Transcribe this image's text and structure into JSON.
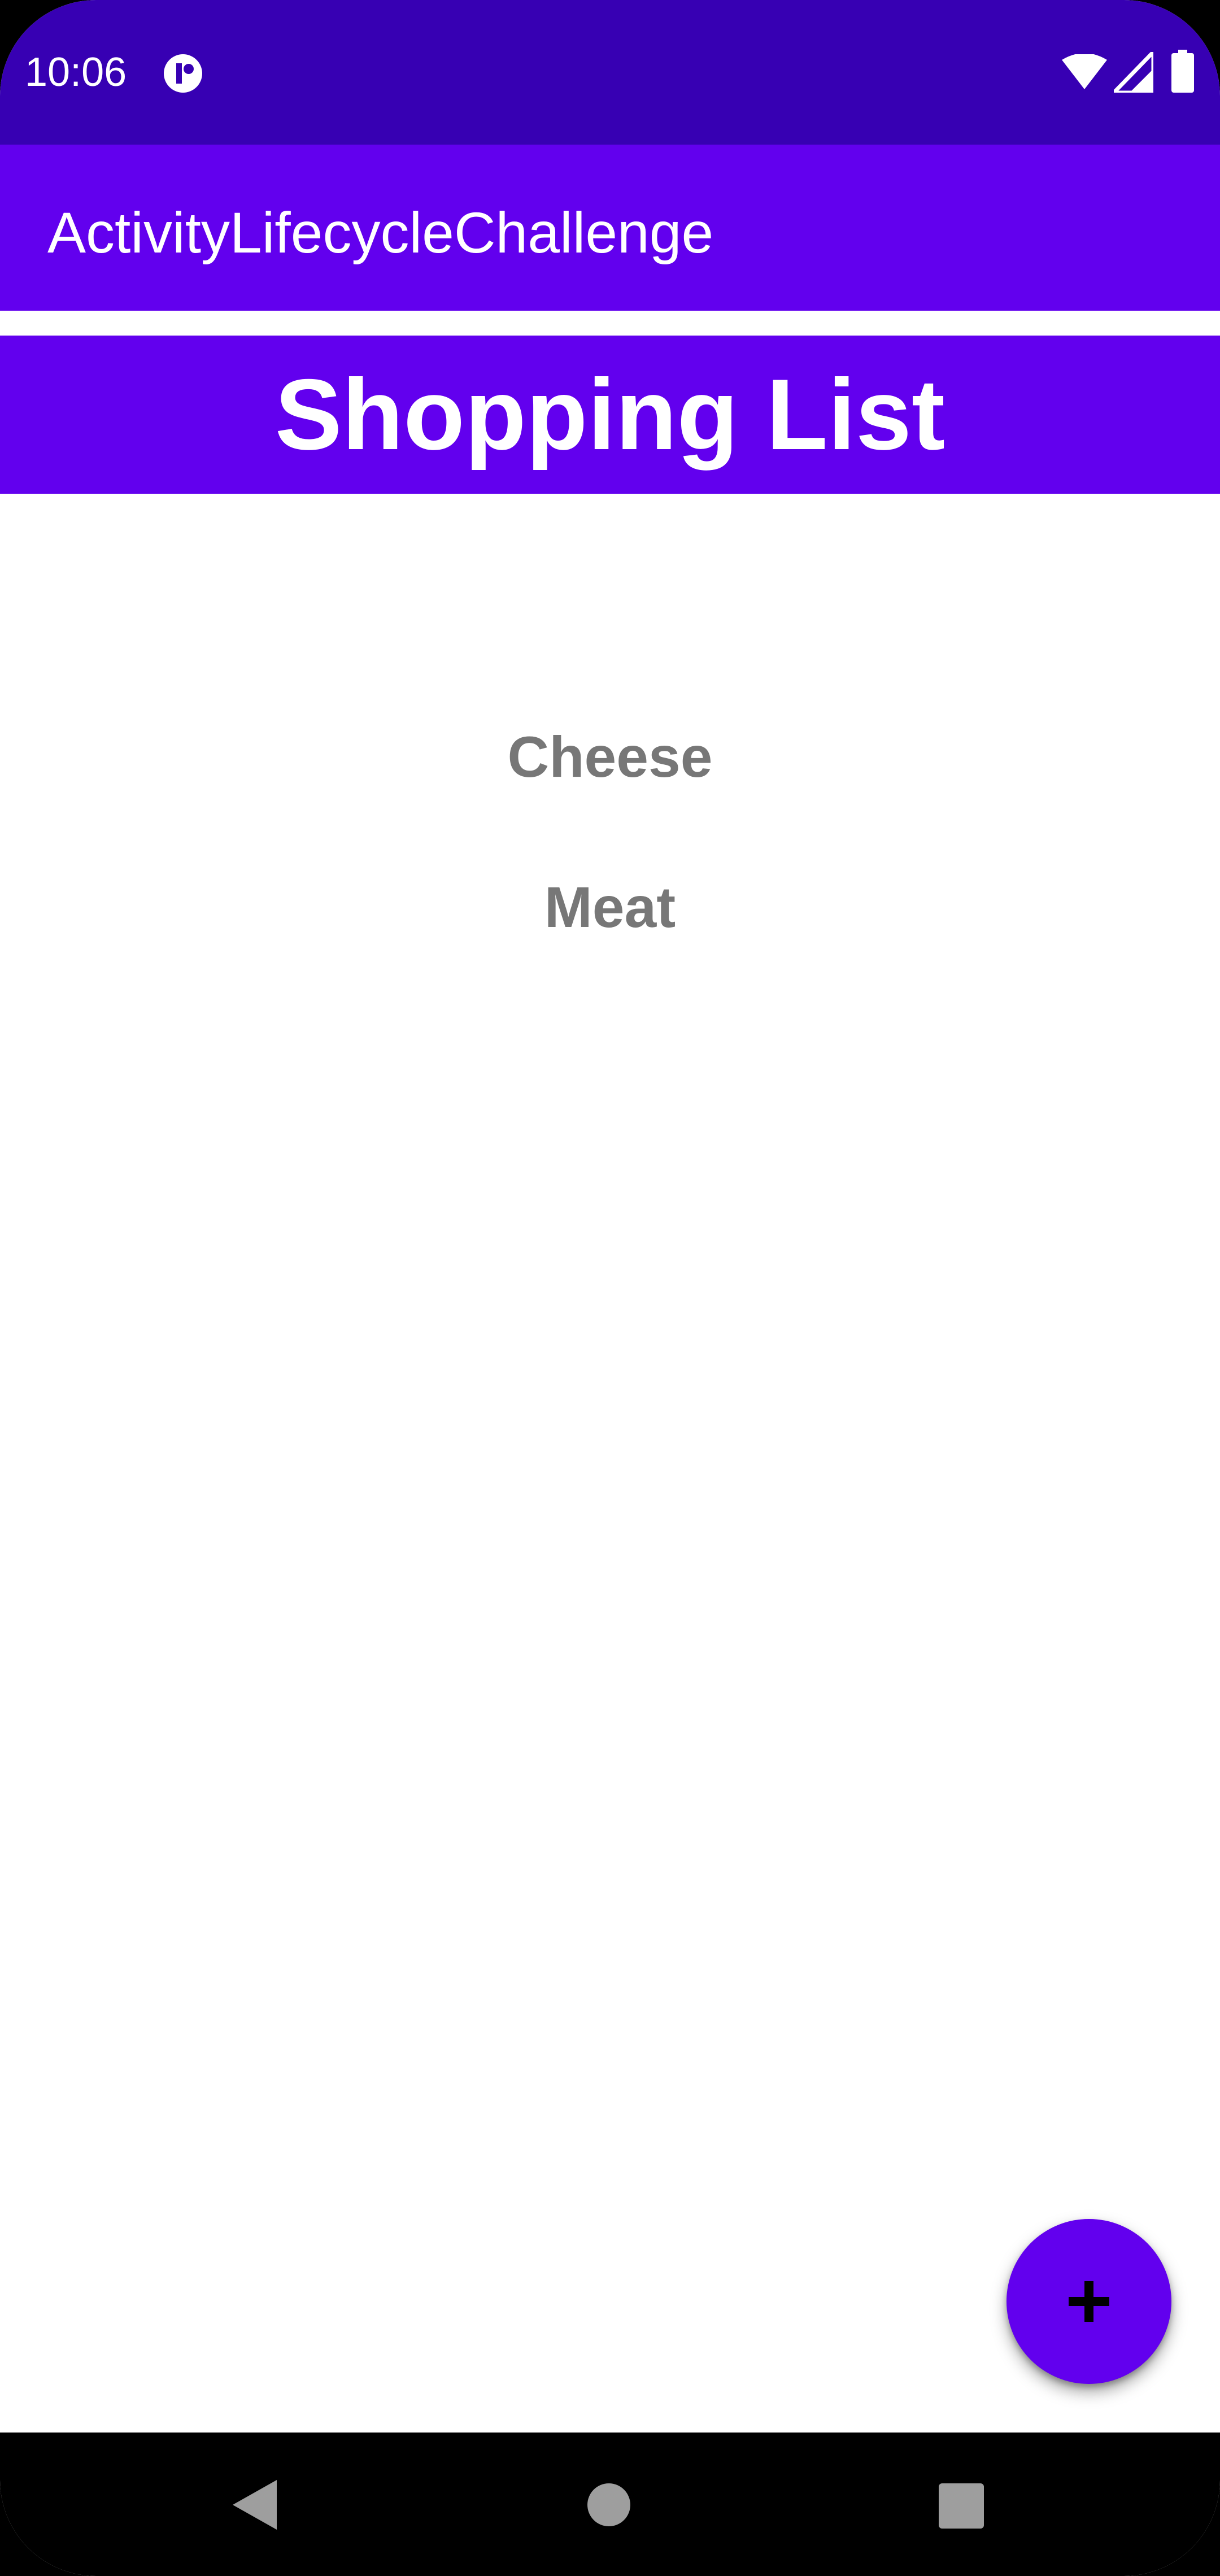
{
  "status_bar": {
    "time": "10:06",
    "icons": [
      "app-notification-icon",
      "wifi-icon",
      "cellular-signal-icon",
      "battery-icon"
    ],
    "background": "#3700B3"
  },
  "app_bar": {
    "title": "ActivityLifecycleChallenge",
    "background": "#6200EE"
  },
  "list_header": {
    "title": "Shopping List",
    "background": "#6200EE"
  },
  "items": [
    {
      "label": "Cheese"
    },
    {
      "label": "Meat"
    }
  ],
  "fab": {
    "icon": "plus-icon",
    "background": "#6200EE"
  },
  "nav_bar": {
    "buttons": [
      "back-icon",
      "home-icon",
      "recents-icon"
    ]
  }
}
